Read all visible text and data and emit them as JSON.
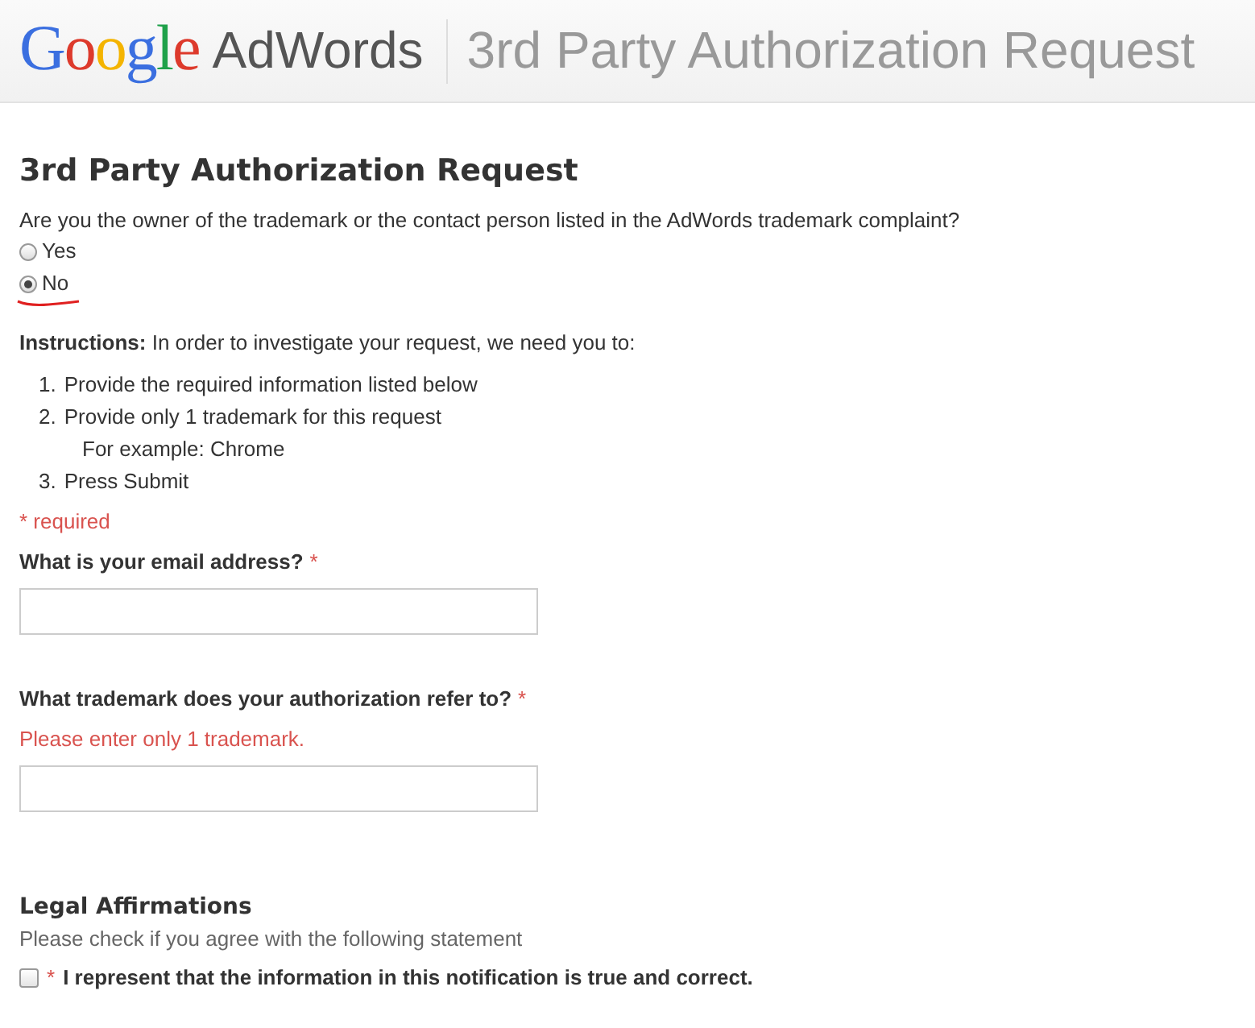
{
  "header": {
    "logo": "Google",
    "product": "AdWords",
    "title": "3rd Party Authorization Request"
  },
  "form": {
    "title": "3rd Party Authorization Request",
    "question": "Are you the owner of the trademark or the contact person listed in the AdWords trademark complaint?",
    "options": [
      {
        "label": "Yes",
        "selected": false,
        "underlined": false
      },
      {
        "label": "No",
        "selected": true,
        "underlined": true
      }
    ],
    "instructions": "**Instructions:** In order to investigate your request, we need you to:",
    "steps": [
      {
        "number": "1.",
        "text": "Provide the required information listed below"
      },
      {
        "number": "2.",
        "text": "Provide only 1 trademark for this request",
        "children": [
          {
            "text": "For example: Chrome"
          }
        ]
      },
      {
        "number": "3.",
        "text": "Press Submit"
      }
    ],
    "required_note": "* required",
    "fields": [
      {
        "label": "What is your email address?",
        "required_mark": "*"
      },
      {
        "label": "What trademark does your authorization refer to?",
        "required_mark": "*",
        "hint": "Please enter only 1 trademark."
      }
    ],
    "legal": {
      "title": "Legal Affirmations",
      "subtitle": "Please check if you agree with the following statement",
      "checked": false,
      "required_mark": "*",
      "statement": "I represent that the information in this notification is true and correct."
    }
  }
}
